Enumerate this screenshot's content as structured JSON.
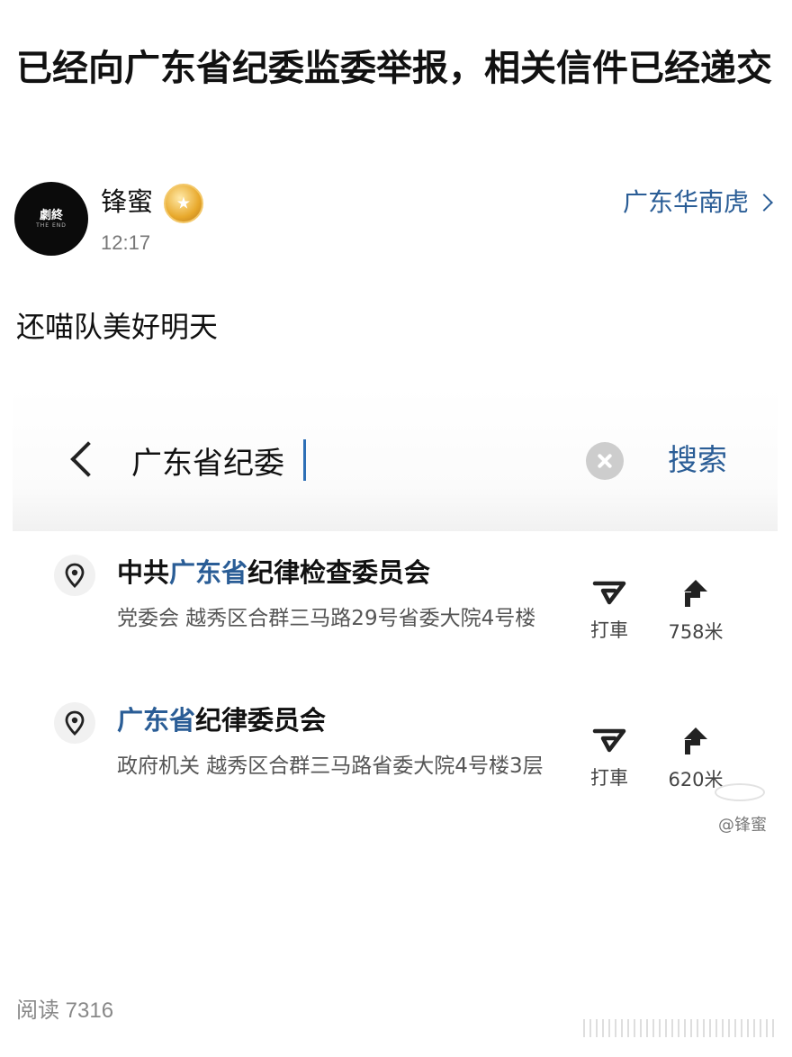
{
  "post": {
    "title": "已经向广东省纪委监委举报，相关信件已经递交",
    "author": {
      "avatar_text": "劇終",
      "avatar_subtext": "THE END",
      "name": "锋蜜",
      "time": "12:17",
      "badge_icon": "medal-icon"
    },
    "topic_link": "广东华南虎",
    "body": "还喵队美好明天",
    "read_label": "阅读",
    "read_count": "7316"
  },
  "screenshot": {
    "search": {
      "value": "广东省纪委",
      "search_button": "搜索"
    },
    "results": [
      {
        "name_prefix": "中共",
        "name_highlight": "广东省",
        "name_suffix": "纪律检查委员会",
        "description": "党委会  越秀区合群三马路29号省委大院4号楼",
        "taxi_label": "打車",
        "distance": "758米"
      },
      {
        "name_prefix": "",
        "name_highlight": "广东省",
        "name_suffix": "纪律委员会",
        "description": "政府机关  越秀区合群三马路省委大院4号楼3层",
        "taxi_label": "打車",
        "distance": "620米"
      }
    ],
    "watermark": "@锋蜜"
  },
  "colors": {
    "link_blue": "#2a5d96",
    "text": "#111111",
    "muted": "#777777"
  }
}
